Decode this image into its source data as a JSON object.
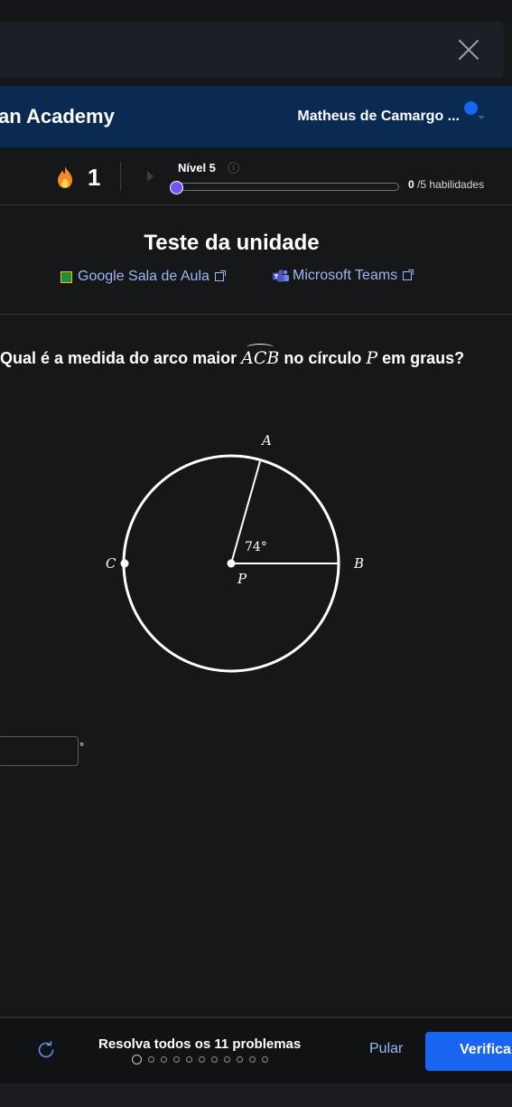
{
  "header": {
    "brand": "an Academy",
    "user_name": "Matheus de Camargo ..."
  },
  "progress": {
    "streak_count": "1",
    "level_label": "Nível 5",
    "info_icon_glyph": "i",
    "skills_done": "0",
    "skills_total_label": " /5 habilidades",
    "progress_fraction": 0
  },
  "unit": {
    "title": "Teste da unidade",
    "classroom_label": "Google Sala de Aula",
    "teams_label": "Microsoft Teams"
  },
  "question": {
    "prefix": "Qual é a medida do arco maior ",
    "arc_label": "ACB",
    "middle": " no círculo ",
    "circle_label": "P",
    "suffix": " em graus?"
  },
  "figure": {
    "point_a": "A",
    "point_b": "B",
    "point_c": "C",
    "point_p": "P",
    "angle_label": "74°"
  },
  "answer": {
    "unit": "°"
  },
  "footer": {
    "instruction": "Resolva todos os 11 problemas",
    "problems_total": 11,
    "current_problem": 1,
    "skip_label": "Pular",
    "verify_label": "Verifica"
  },
  "colors": {
    "header_bg": "#0b2a52",
    "accent_blue": "#1865f2",
    "progress_knob": "#7854f7",
    "link": "#9db7f5",
    "streak_flame": "#f58a2a"
  }
}
